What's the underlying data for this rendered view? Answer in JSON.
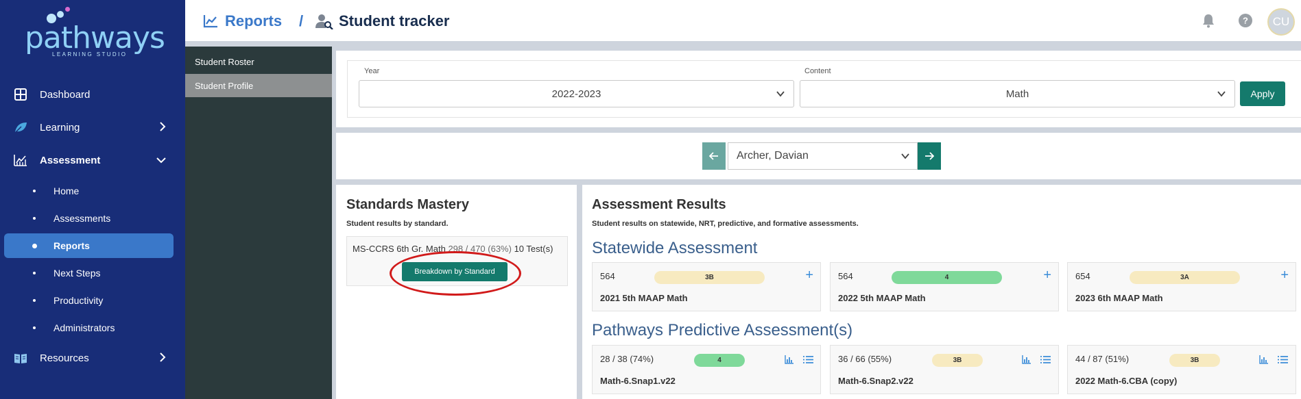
{
  "brand": {
    "name": "pathways",
    "tagline": "LEARNING STUDIO"
  },
  "colors": {
    "sidebar": "#182d78",
    "accent_blue": "#3a78c9",
    "teal": "#147a6c",
    "pill_yellow": "#f7eac0",
    "pill_green": "#7fd99a",
    "annotation_red": "#d11a1a"
  },
  "sidebar": {
    "dashboard": "Dashboard",
    "learning": "Learning",
    "assessment": "Assessment",
    "sub": [
      "Home",
      "Assessments",
      "Reports",
      "Next Steps",
      "Productivity",
      "Administrators"
    ],
    "resources": "Resources"
  },
  "header": {
    "reports": "Reports",
    "separator": "/",
    "current": "Student tracker",
    "avatar": "CU",
    "icons": [
      "chart-line-icon",
      "user-search-icon",
      "bell-icon",
      "help-icon"
    ]
  },
  "subnav": {
    "items": [
      "Student Roster",
      "Student Profile"
    ],
    "active": "Student Profile"
  },
  "filters": {
    "year_label": "Year",
    "year_value": "2022-2023",
    "content_label": "Content",
    "content_value": "Math",
    "apply": "Apply"
  },
  "student": {
    "selected": "Archer, Davian"
  },
  "standards": {
    "title": "Standards Mastery",
    "subtitle": "Student results by standard.",
    "name": "MS-CCRS 6th Gr. Math",
    "score": "298 / 470 (63%)",
    "tests": "10 Test(s)",
    "button": "Breakdown by Standard"
  },
  "results": {
    "title": "Assessment Results",
    "subtitle": "Student results on statewide, NRT, predictive, and formative assessments.",
    "statewide_heading": "Statewide Assessment",
    "statewide": [
      {
        "score": "564",
        "level": "3B",
        "name": "2021 5th MAAP Math",
        "pill_color": "#f7eac0"
      },
      {
        "score": "564",
        "level": "4",
        "name": "2022 5th MAAP Math",
        "pill_color": "#7fd99a"
      },
      {
        "score": "654",
        "level": "3A",
        "name": "2023 6th MAAP Math",
        "pill_color": "#f7eac0"
      }
    ],
    "predictive_heading": "Pathways Predictive Assessment(s)",
    "predictive": [
      {
        "score": "28 / 38 (74%)",
        "level": "4",
        "name": "Math-6.Snap1.v22",
        "pill_color": "#7fd99a"
      },
      {
        "score": "36 / 66 (55%)",
        "level": "3B",
        "name": "Math-6.Snap2.v22",
        "pill_color": "#f7eac0"
      },
      {
        "score": "44 / 87 (51%)",
        "level": "3B",
        "name": "2022 Math-6.CBA (copy)",
        "pill_color": "#f7eac0"
      }
    ]
  }
}
